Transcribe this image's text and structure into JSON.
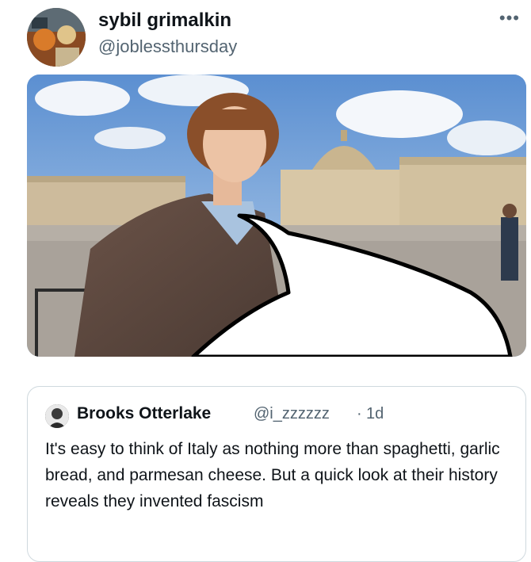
{
  "tweet": {
    "display_name": "sybil grimalkin",
    "handle": "@joblessthursday",
    "more_icon": "more-horizontal-icon",
    "more_glyph": "•••"
  },
  "media": {
    "description_icon": "photo-speech-bubble"
  },
  "quoted_tweet": {
    "author_name": "Brooks Otterlake",
    "author_handle": "@i_zzzzzz",
    "separator": "·",
    "time_ago": "1d",
    "text": "It's easy to think of Italy as nothing more than spaghetti, garlic bread, and parmesan cheese. But a quick look at their history reveals they invented fascism"
  },
  "colors": {
    "text_primary": "#0f1419",
    "text_secondary": "#536471",
    "border": "#cfd9de"
  }
}
